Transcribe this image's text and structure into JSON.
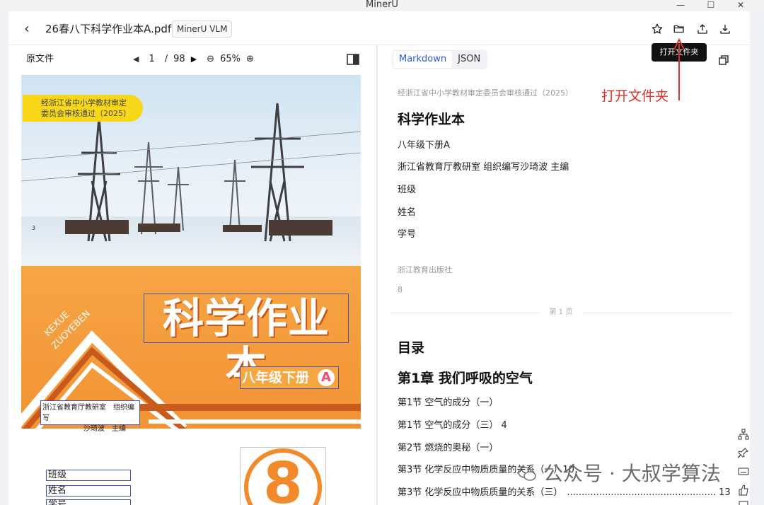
{
  "window": {
    "title": "MinerU"
  },
  "header": {
    "file_title": "26春八下科学作业本A.pdf",
    "model_badge": "MinerU VLM"
  },
  "tooltip": "打开文件夹",
  "annotation": "打开文件夹",
  "left_pane": {
    "label": "原文件",
    "page_current": "1",
    "page_sep": "/",
    "page_total": "98",
    "zoom": "65%"
  },
  "cover": {
    "cert_line1": "经浙江省中小学教材审定",
    "cert_line2": "委员会审核通过（2025）",
    "side_text1": "KEXUE",
    "side_text2": "ZUOYEBEN",
    "title": "科学作业本",
    "grade": "八年级下册",
    "grade_letter": "A",
    "editor_line1": "浙江省教育厅教研室　组织编写",
    "editor_line2": "沙琦波　主编",
    "field_class": "班级",
    "field_name": "姓名",
    "field_id": "学号",
    "big_number": "8",
    "small_marker": "3"
  },
  "right_pane": {
    "tabs": [
      {
        "label": "Markdown",
        "active": true
      },
      {
        "label": "JSON",
        "active": false
      }
    ],
    "md": {
      "approval": "经浙江省中小学教材审定委员会审核通过（2025）",
      "title": "科学作业本",
      "grade": "八年级下册A",
      "editor": "浙江省教育厅教研室 组织编写沙琦波 主编",
      "field_class": "班级",
      "field_name": "姓名",
      "field_id": "学号",
      "publisher": "浙江教育出版社",
      "num": "8",
      "page_label": "第 1 页",
      "toc_title": "目录",
      "chapter1": "第1章 我们呼吸的空气",
      "toc_items": [
        "第1节 空气的成分（一）",
        "第1节 空气的成分（三） 4",
        "第2节 燃烧的奥秘（一）",
        "第3节 化学反应中物质质量的关系（一）10",
        "第3节 化学反应中物质质量的关系（三）"
      ],
      "toc_last_dots": "...................................................",
      "toc_last_page": "13"
    }
  },
  "watermark": "公众号 · 大叔学算法",
  "colors": {
    "accent": "#2f5fd0",
    "annotation": "#e0312b",
    "cover_orange": "#f18a2c",
    "cert_yellow": "#f7d717"
  }
}
